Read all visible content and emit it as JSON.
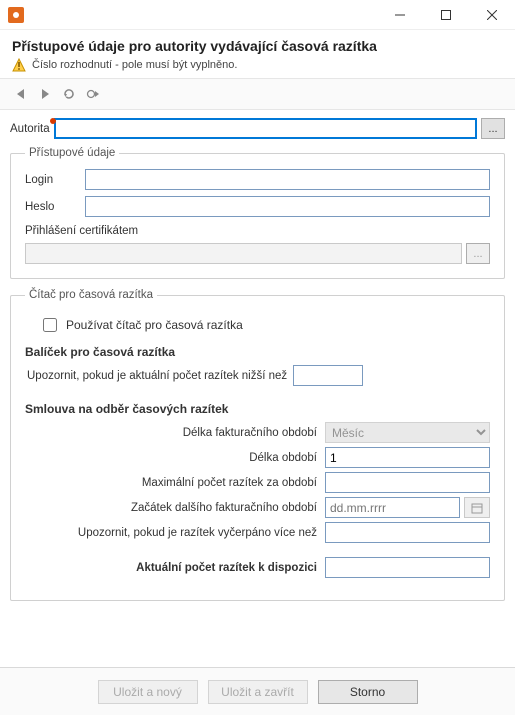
{
  "window": {
    "title": "",
    "header_title": "Přístupové údaje pro autority vydávající časová razítka",
    "warning_text": "Číslo rozhodnutí - pole musí být vyplněno."
  },
  "toolbar": {
    "back": "back",
    "forward": "forward",
    "refresh": "refresh",
    "commit": "commit"
  },
  "authority": {
    "label": "Autorita",
    "value": "",
    "browse": "..."
  },
  "access_group": {
    "legend": "Přístupové údaje",
    "login_label": "Login",
    "login_value": "",
    "password_label": "Heslo",
    "password_value": "",
    "cert_label": "Přihlášení certifikátem",
    "cert_value": "",
    "cert_browse": "..."
  },
  "counter_group": {
    "legend": "Čítač pro časová razítka",
    "use_counter_label": "Používat čítač pro časová razítka",
    "use_counter_checked": false,
    "package_title": "Balíček pro časová razítka",
    "notify_low_label": "Upozornit, pokud je aktuální počet razítek nižší než",
    "notify_low_value": "",
    "contract_title": "Smlouva na odběr časových razítek",
    "rows": {
      "billing_period_len_label": "Délka fakturačního období",
      "billing_period_len_value": "Měsíc",
      "period_len_label": "Délka období",
      "period_len_value": "1",
      "max_stamps_label": "Maximální počet razítek za období",
      "max_stamps_value": "",
      "next_billing_start_label": "Začátek dalšího fakturačního období",
      "next_billing_start_placeholder": "dd.mm.rrrr",
      "next_billing_start_value": "",
      "notify_exhausted_label": "Upozornit, pokud je razítek vyčerpáno více než",
      "notify_exhausted_value": "",
      "current_available_label": "Aktuální počet razítek k dispozici",
      "current_available_value": ""
    }
  },
  "footer": {
    "save_new": "Uložit a nový",
    "save_close": "Uložit a zavřít",
    "cancel": "Storno"
  }
}
